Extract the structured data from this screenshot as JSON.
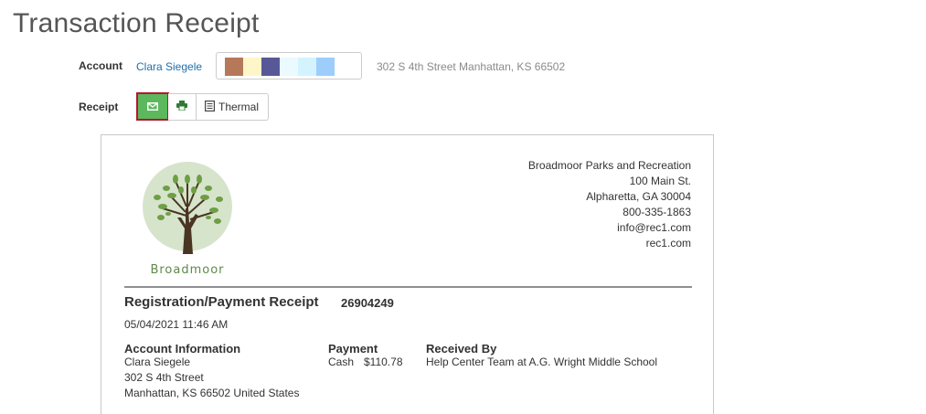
{
  "page": {
    "title": "Transaction Receipt"
  },
  "account": {
    "label": "Account",
    "name": "Clara Siegele",
    "swatches": [
      "#b5795a",
      "#fef6c9",
      "#585899",
      "#eafaff",
      "#d3f3ff",
      "#9ccdfb"
    ],
    "address": "302 S 4th Street Manhattan, KS 66502"
  },
  "receipt_toolbar": {
    "label": "Receipt",
    "email_icon": "envelope-icon",
    "print_icon": "printer-icon",
    "thermal_icon": "document-icon",
    "thermal_label": "Thermal"
  },
  "receipt": {
    "logo_text": "Broadmoor",
    "org": {
      "name": "Broadmoor Parks and Recreation",
      "street": "100 Main St.",
      "city": "Alpharetta, GA 30004",
      "phone": "800-335-1863",
      "email": "info@rec1.com",
      "website": "rec1.com"
    },
    "title": "Registration/Payment Receipt",
    "number": "26904249",
    "date": "05/04/2021 11:46 AM",
    "account_info": {
      "heading": "Account Information",
      "name": "Clara Siegele",
      "street": "302 S 4th Street",
      "city": "Manhattan, KS 66502 United States"
    },
    "payment": {
      "heading": "Payment",
      "method": "Cash",
      "amount": "$110.78"
    },
    "received_by": {
      "heading": "Received By",
      "value": "Help Center Team at A.G. Wright Middle School"
    }
  }
}
